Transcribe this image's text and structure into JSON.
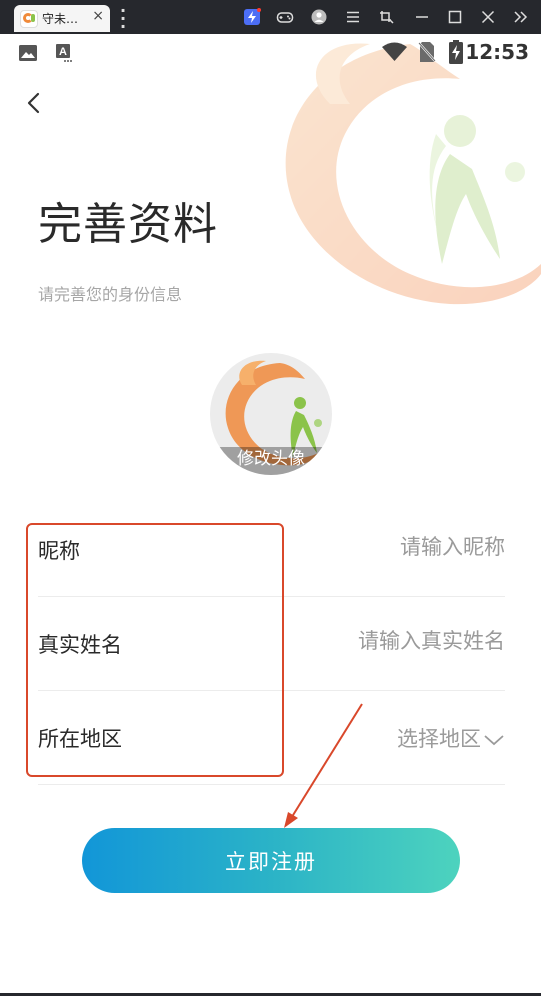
{
  "window": {
    "tab_title": "守未…",
    "tab_close": "×",
    "controls": [
      "lightning-icon",
      "gamepad-icon",
      "user-circle-icon",
      "menu-icon",
      "screenshot-icon",
      "minimize-icon",
      "maximize-icon",
      "close-icon",
      "double-chevron-icon"
    ]
  },
  "status_bar": {
    "time": "12:53",
    "icons": [
      "image-icon",
      "text-a-icon",
      "wifi-icon",
      "no-sim-icon",
      "battery-charging-icon"
    ]
  },
  "page": {
    "title": "完善资料",
    "subtitle": "请完善您的身份信息",
    "avatar_caption": "修改头像",
    "fields": [
      {
        "label": "昵称",
        "placeholder": "请输入昵称",
        "value": ""
      },
      {
        "label": "真实姓名",
        "placeholder": "请输入真实姓名",
        "value": ""
      },
      {
        "label": "所在地区",
        "select_text": "选择地区"
      }
    ],
    "register_button": "立即注册"
  },
  "colors": {
    "highlight_border": "#d9482b",
    "button_gradient_start": "#1296d8",
    "button_gradient_end": "#4dd3be",
    "placeholder": "#9a9a9a",
    "logo_orange": "#f0893c",
    "logo_green": "#8bc34a"
  }
}
